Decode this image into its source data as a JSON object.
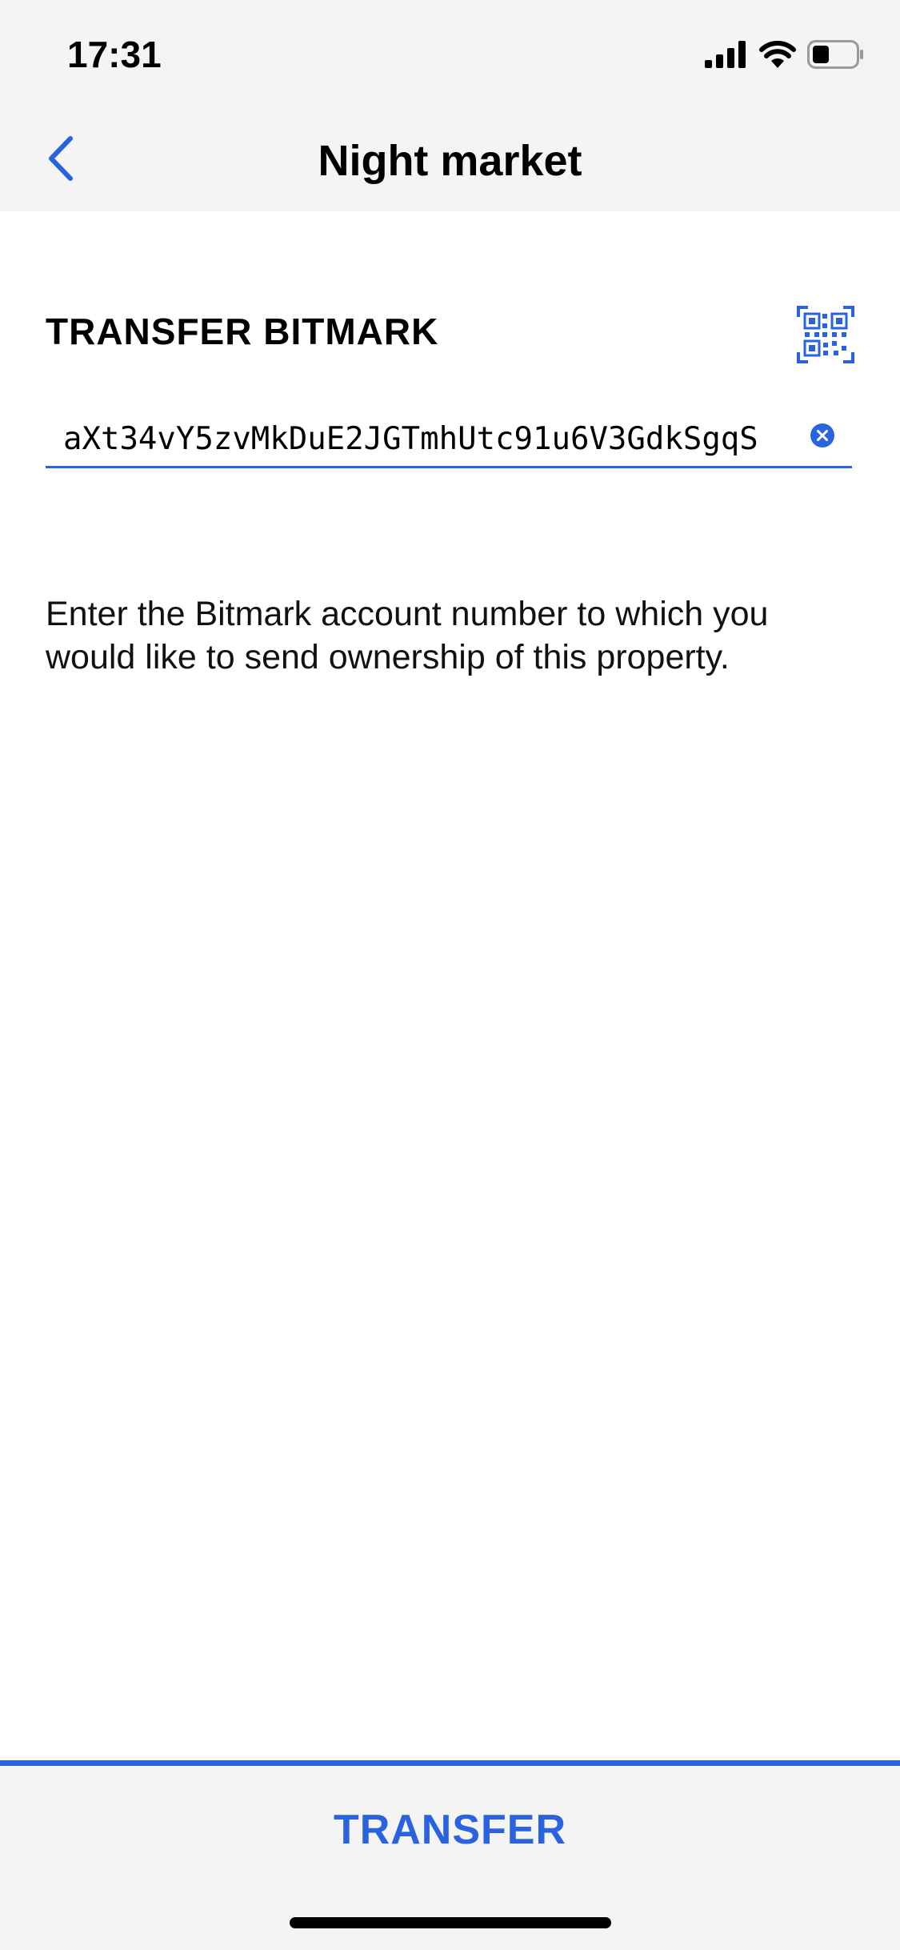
{
  "status_bar": {
    "time": "17:31",
    "icons": [
      "signal-icon",
      "wifi-icon",
      "battery-icon"
    ]
  },
  "nav": {
    "back_icon": "chevron-left-icon",
    "title": "Night market"
  },
  "transfer_form": {
    "section_title": "TRANSFER BITMARK",
    "qr_icon": "qr-code-icon",
    "address_value": "aXt34vY5zvMkDuE2JGTmhUtc91u6V3GdkSgqS",
    "clear_icon": "clear-circle-icon",
    "helper_text": "Enter the Bitmark account number to which you would like to send ownership of this property."
  },
  "bottom_bar": {
    "transfer_label": "TRANSFER"
  },
  "colors": {
    "accent": "#2a63e0",
    "header_bg": "#f4f4f4",
    "content_bg": "#ffffff"
  }
}
